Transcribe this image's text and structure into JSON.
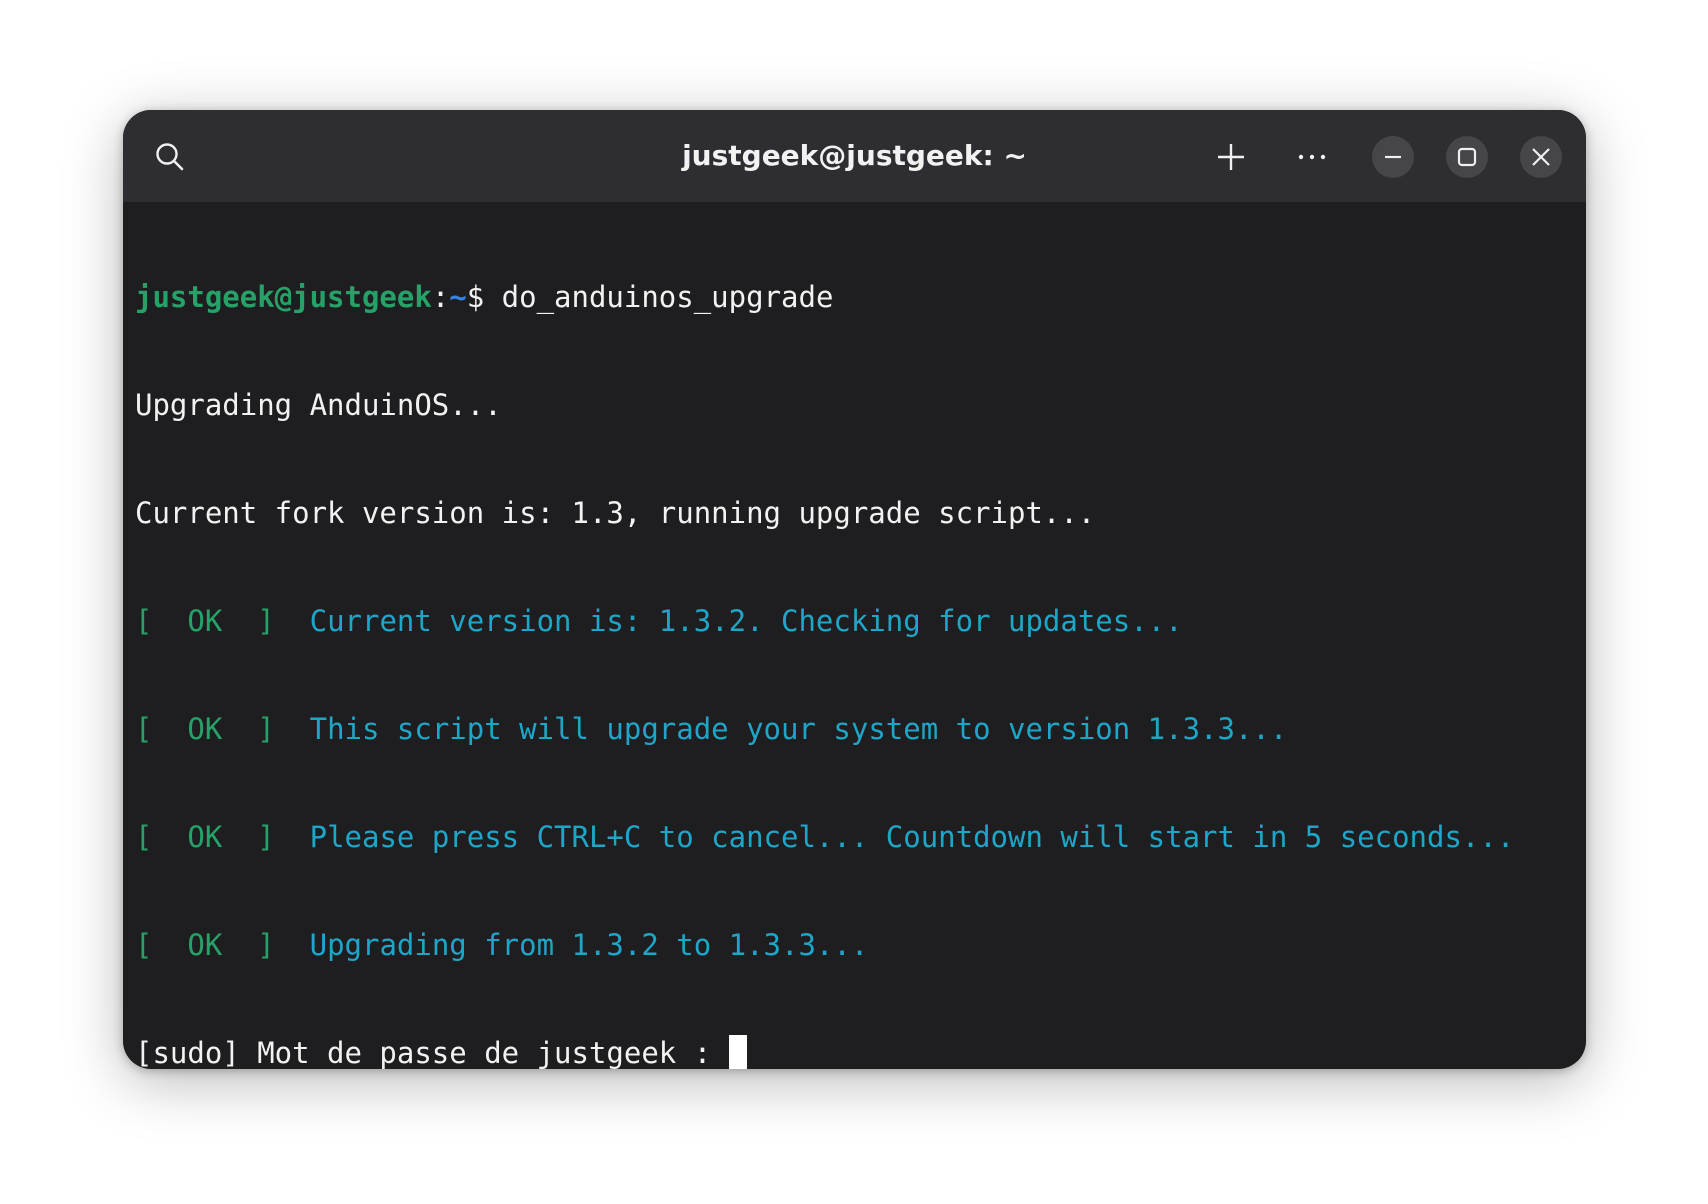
{
  "window": {
    "title": "justgeek@justgeek: ~"
  },
  "toolbar": {
    "search_icon": "search-icon",
    "new_tab_icon": "plus-icon",
    "menu_icon": "ellipsis-icon",
    "minimize_icon": "minimize-icon",
    "maximize_icon": "maximize-icon",
    "close_icon": "close-icon"
  },
  "terminal": {
    "prompt_user": "justgeek@justgeek",
    "prompt_colon": ":",
    "prompt_path": "~",
    "prompt_symbol": "$ ",
    "command": "do_anduinos_upgrade",
    "lines": [
      "Upgrading AnduinOS...",
      "Current fork version is: 1.3, running upgrade script..."
    ],
    "ok_lines": [
      {
        "status": "[  OK  ]  ",
        "message": "Current version is: 1.3.2. Checking for updates..."
      },
      {
        "status": "[  OK  ]  ",
        "message": "This script will upgrade your system to version 1.3.3..."
      },
      {
        "status": "[  OK  ]  ",
        "message": "Please press CTRL+C to cancel... Countdown will start in 5 seconds..."
      },
      {
        "status": "[  OK  ]  ",
        "message": "Upgrading from 1.3.2 to 1.3.3..."
      }
    ],
    "sudo_prompt": "[sudo] Mot de passe de justgeek : "
  },
  "colors": {
    "window_bg": "#1e1e20",
    "titlebar_bg": "#2e2e32",
    "prompt_user": "#26a269",
    "prompt_path": "#3584e4",
    "ok_status": "#26a269",
    "info_text": "#1ea6c9",
    "text": "#f2f2f2"
  }
}
